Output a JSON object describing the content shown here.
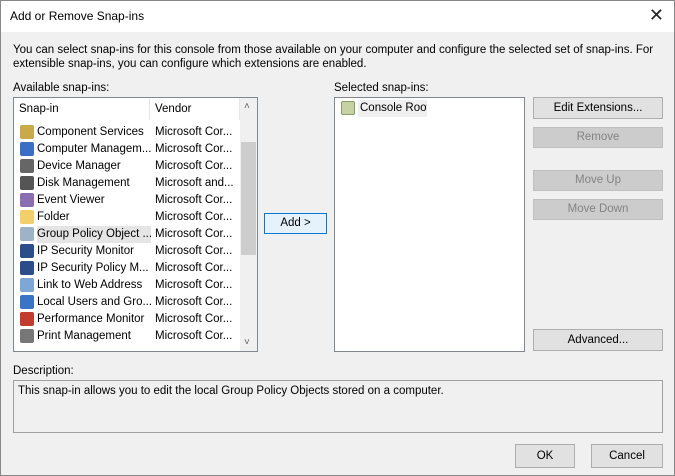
{
  "title": "Add or Remove Snap-ins",
  "intro": "You can select snap-ins for this console from those available on your computer and configure the selected set of snap-ins. For extensible snap-ins, you can configure which extensions are enabled.",
  "available_label": "Available snap-ins:",
  "selected_label": "Selected snap-ins:",
  "columns": [
    "Snap-in",
    "Vendor"
  ],
  "snapins": [
    {
      "name": "Component Services",
      "vendor": "Microsoft Cor...",
      "icon": "gear-icon",
      "color": "#c9a94a"
    },
    {
      "name": "Computer Managem...",
      "vendor": "Microsoft Cor...",
      "icon": "computer-icon",
      "color": "#3b6fc4"
    },
    {
      "name": "Device Manager",
      "vendor": "Microsoft Cor...",
      "icon": "device-icon",
      "color": "#666666"
    },
    {
      "name": "Disk Management",
      "vendor": "Microsoft and...",
      "icon": "disk-icon",
      "color": "#555555"
    },
    {
      "name": "Event Viewer",
      "vendor": "Microsoft Cor...",
      "icon": "event-log-icon",
      "color": "#8a6fb0"
    },
    {
      "name": "Folder",
      "vendor": "Microsoft Cor...",
      "icon": "folder-icon",
      "color": "#f2cf6a"
    },
    {
      "name": "Group Policy Object ...",
      "vendor": "Microsoft Cor...",
      "icon": "policy-scroll-icon",
      "color": "#9fb3c8"
    },
    {
      "name": "IP Security Monitor",
      "vendor": "Microsoft Cor...",
      "icon": "ip-security-icon",
      "color": "#2d4d8a"
    },
    {
      "name": "IP Security Policy M...",
      "vendor": "Microsoft Cor...",
      "icon": "ip-security-icon",
      "color": "#2d4d8a"
    },
    {
      "name": "Link to Web Address",
      "vendor": "Microsoft Cor...",
      "icon": "web-link-icon",
      "color": "#7fa7d6"
    },
    {
      "name": "Local Users and Gro...",
      "vendor": "Microsoft Cor...",
      "icon": "users-icon",
      "color": "#3b74c4"
    },
    {
      "name": "Performance Monitor",
      "vendor": "Microsoft Cor...",
      "icon": "performance-icon",
      "color": "#c23b2f"
    },
    {
      "name": "Print Management",
      "vendor": "Microsoft Cor...",
      "icon": "printer-icon",
      "color": "#777777"
    }
  ],
  "selected_index": 6,
  "selected_items": [
    {
      "name": "Console Root",
      "icon": "folder-icon"
    }
  ],
  "buttons": {
    "add": "Add >",
    "edit_extensions": "Edit Extensions...",
    "remove": "Remove",
    "move_up": "Move Up",
    "move_down": "Move Down",
    "advanced": "Advanced...",
    "ok": "OK",
    "cancel": "Cancel"
  },
  "description_label": "Description:",
  "description": "This snap-in allows you to edit the local Group Policy Objects stored on a computer."
}
